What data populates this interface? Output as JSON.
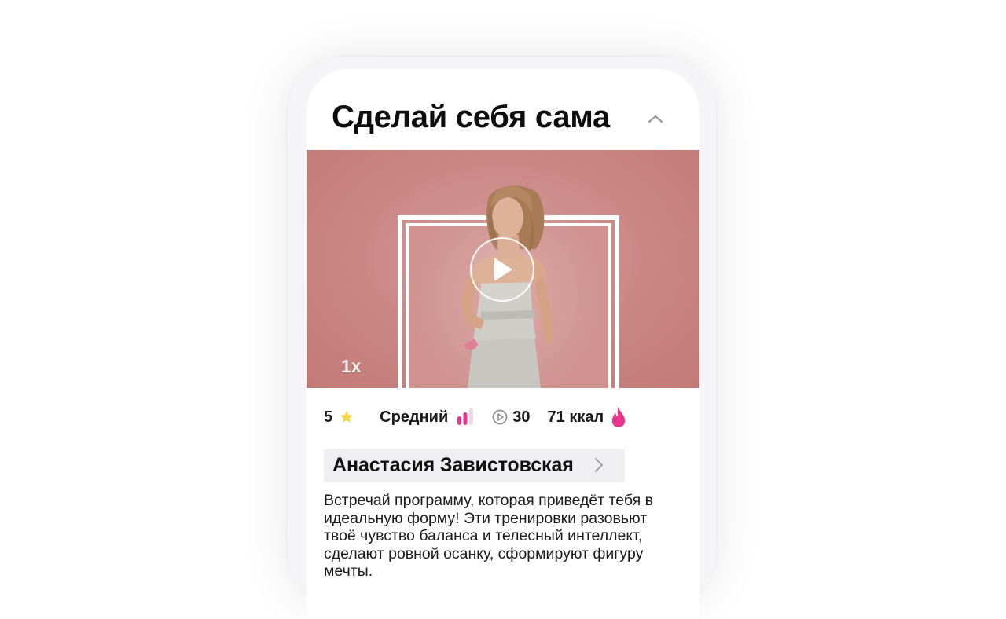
{
  "workout": {
    "title": "Сделай себя сама",
    "speed": "1x"
  },
  "stats": {
    "rating": "5",
    "level": "Средний",
    "duration": "30",
    "calories": "71 ккал"
  },
  "author": {
    "name": "Анастасия Завистовская"
  },
  "description": "Встречай программу, которая приведёт тебя в идеальную форму! Эти тренировки разовьют твоё чувство баланса и телесный интеллект, сделают ровной осанку, сформируют фигуру мечты.",
  "colors": {
    "accent": "#e8368f",
    "star": "#f5d54a",
    "video_bg": "#c98683"
  },
  "icons": {
    "collapse": "chevron-up-icon",
    "play": "play-icon",
    "rating": "star-icon",
    "level": "level-bars-icon",
    "duration": "play-circle-icon",
    "calories": "flame-icon",
    "author_link": "chevron-right-icon"
  }
}
